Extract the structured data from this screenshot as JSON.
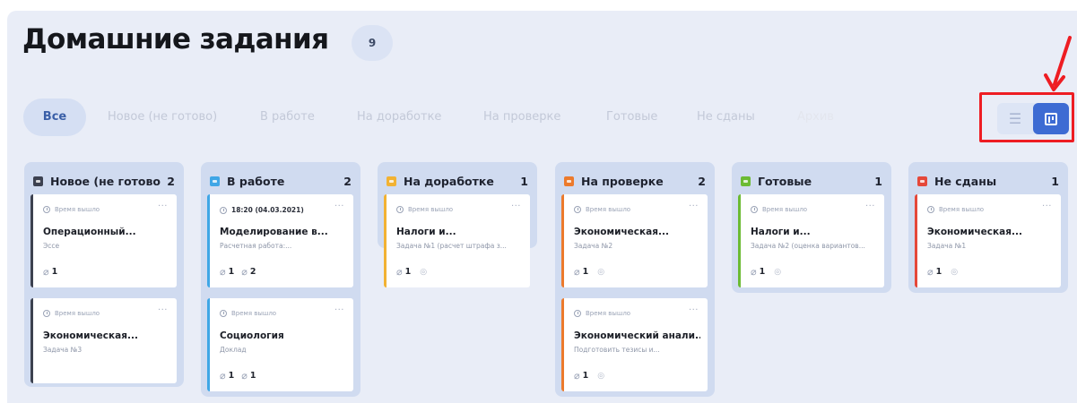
{
  "page": {
    "title": "Домашние задания",
    "total_count": "9"
  },
  "tabs": [
    {
      "label": "Все",
      "active": true
    },
    {
      "label": "Новое (не готово)"
    },
    {
      "label": "В работе"
    },
    {
      "label": "На доработке"
    },
    {
      "label": "На проверке"
    },
    {
      "label": "Готовые"
    },
    {
      "label": "Не сданы"
    },
    {
      "label": "Архив"
    }
  ],
  "view_toggle": {
    "list_icon": "list-icon",
    "board_icon": "kanban-board-icon",
    "selected": "board"
  },
  "columns": [
    {
      "name": "Новое (не готово)",
      "count": "2",
      "color": "#3c4150",
      "cards": [
        {
          "time": "Время вышло",
          "title": "Операционный...",
          "subtitle": "Эссе",
          "attachments": "1",
          "accent": "#3c4150"
        },
        {
          "time": "Время вышло",
          "title": "Экономическая...",
          "subtitle": "Задача №3",
          "accent": "#3c4150"
        }
      ]
    },
    {
      "name": "В работе",
      "count": "2",
      "color": "#3fa6e6",
      "cards": [
        {
          "time": "18:20 (04.03.2021)",
          "title": "Моделирование в...",
          "subtitle": "Расчетная работа:...",
          "attachments": "1",
          "links": "2",
          "accent": "#3fa6e6"
        },
        {
          "time": "Время вышло",
          "title": "Социология",
          "subtitle": "Доклад",
          "attachments": "1",
          "links": "1",
          "accent": "#3fa6e6"
        }
      ]
    },
    {
      "name": "На доработке",
      "count": "1",
      "color": "#f2b233",
      "cards": [
        {
          "time": "Время вышло",
          "title": "Налоги и...",
          "subtitle": "Задача №1 (расчет штрафа з...",
          "attachments": "1",
          "accent": "#f2b233"
        }
      ]
    },
    {
      "name": "На проверке",
      "count": "2",
      "color": "#ec7a2c",
      "cards": [
        {
          "time": "Время вышло",
          "title": "Экономическая...",
          "subtitle": "Задача №2",
          "attachments": "1",
          "accent": "#ec7a2c"
        },
        {
          "time": "Время вышло",
          "title": "Экономический анали...",
          "subtitle": "Подготовить тезисы и...",
          "attachments": "1",
          "accent": "#ec7a2c"
        }
      ]
    },
    {
      "name": "Готовые",
      "count": "1",
      "color": "#6cbb33",
      "cards": [
        {
          "time": "Время вышло",
          "title": "Налоги и...",
          "subtitle": "Задача №2 (оценка вариантов...",
          "attachments": "1",
          "accent": "#6cbb33"
        }
      ]
    },
    {
      "name": "Не сданы",
      "count": "1",
      "color": "#e5483a",
      "cards": [
        {
          "time": "Время вышло",
          "title": "Экономическая...",
          "subtitle": "Задача №1",
          "attachments": "1",
          "accent": "#e5483a"
        }
      ]
    }
  ],
  "colors": {
    "accent": "#3d6bd3",
    "highlight_frame": "#ee1d23",
    "background": "#e9edf7"
  }
}
